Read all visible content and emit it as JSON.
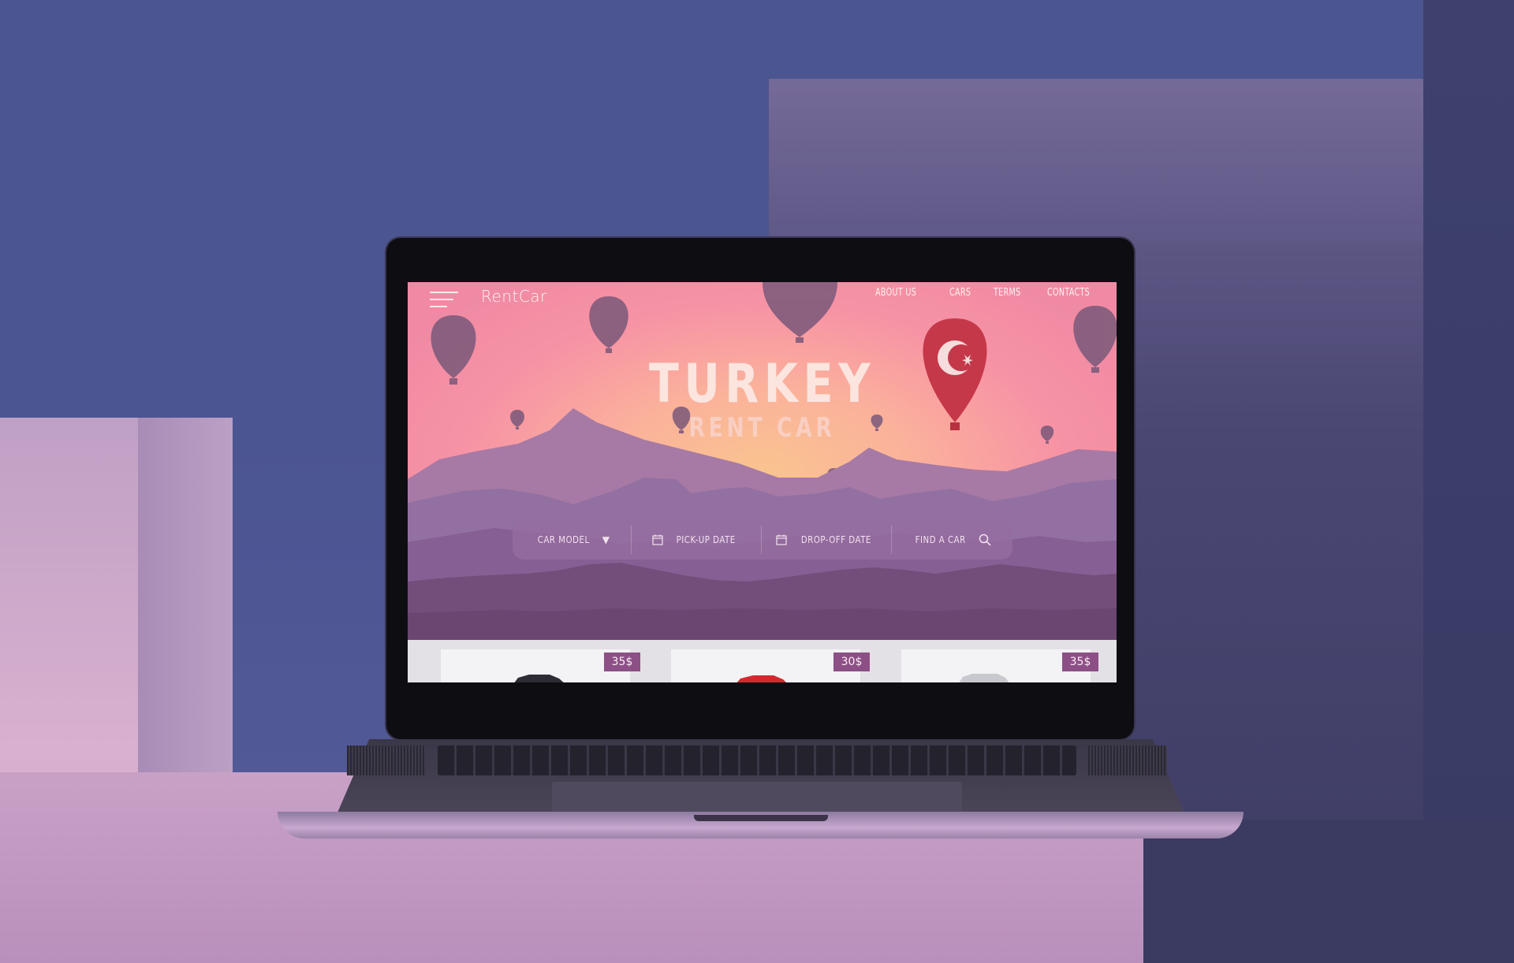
{
  "site": {
    "brand": "RentCar",
    "nav": [
      "ABOUT US",
      "CARS",
      "TERMS",
      "CONTACTS"
    ]
  },
  "hero": {
    "title": "TURKEY",
    "subtitle": "RENT CAR"
  },
  "search": {
    "car_model": "CAR MODEL",
    "pickup": "PICK-UP DATE",
    "dropoff": "DROP-OFF DATE",
    "find": "FIND A CAR"
  },
  "cars": [
    {
      "price": "35$",
      "color": "#2d2b33"
    },
    {
      "price": "30$",
      "color": "#d02a2f"
    },
    {
      "price": "35$",
      "color": "#c7c9ce"
    }
  ],
  "colors": {
    "accent": "#8c4f86",
    "flag_balloon": "#c5384a",
    "balloon": "#7a5879"
  },
  "icons": {
    "menu": "hamburger-menu-icon",
    "dropdown": "caret-down-icon",
    "calendar": "calendar-icon",
    "search": "search-icon",
    "flag": "turkish-crescent-star-icon"
  }
}
